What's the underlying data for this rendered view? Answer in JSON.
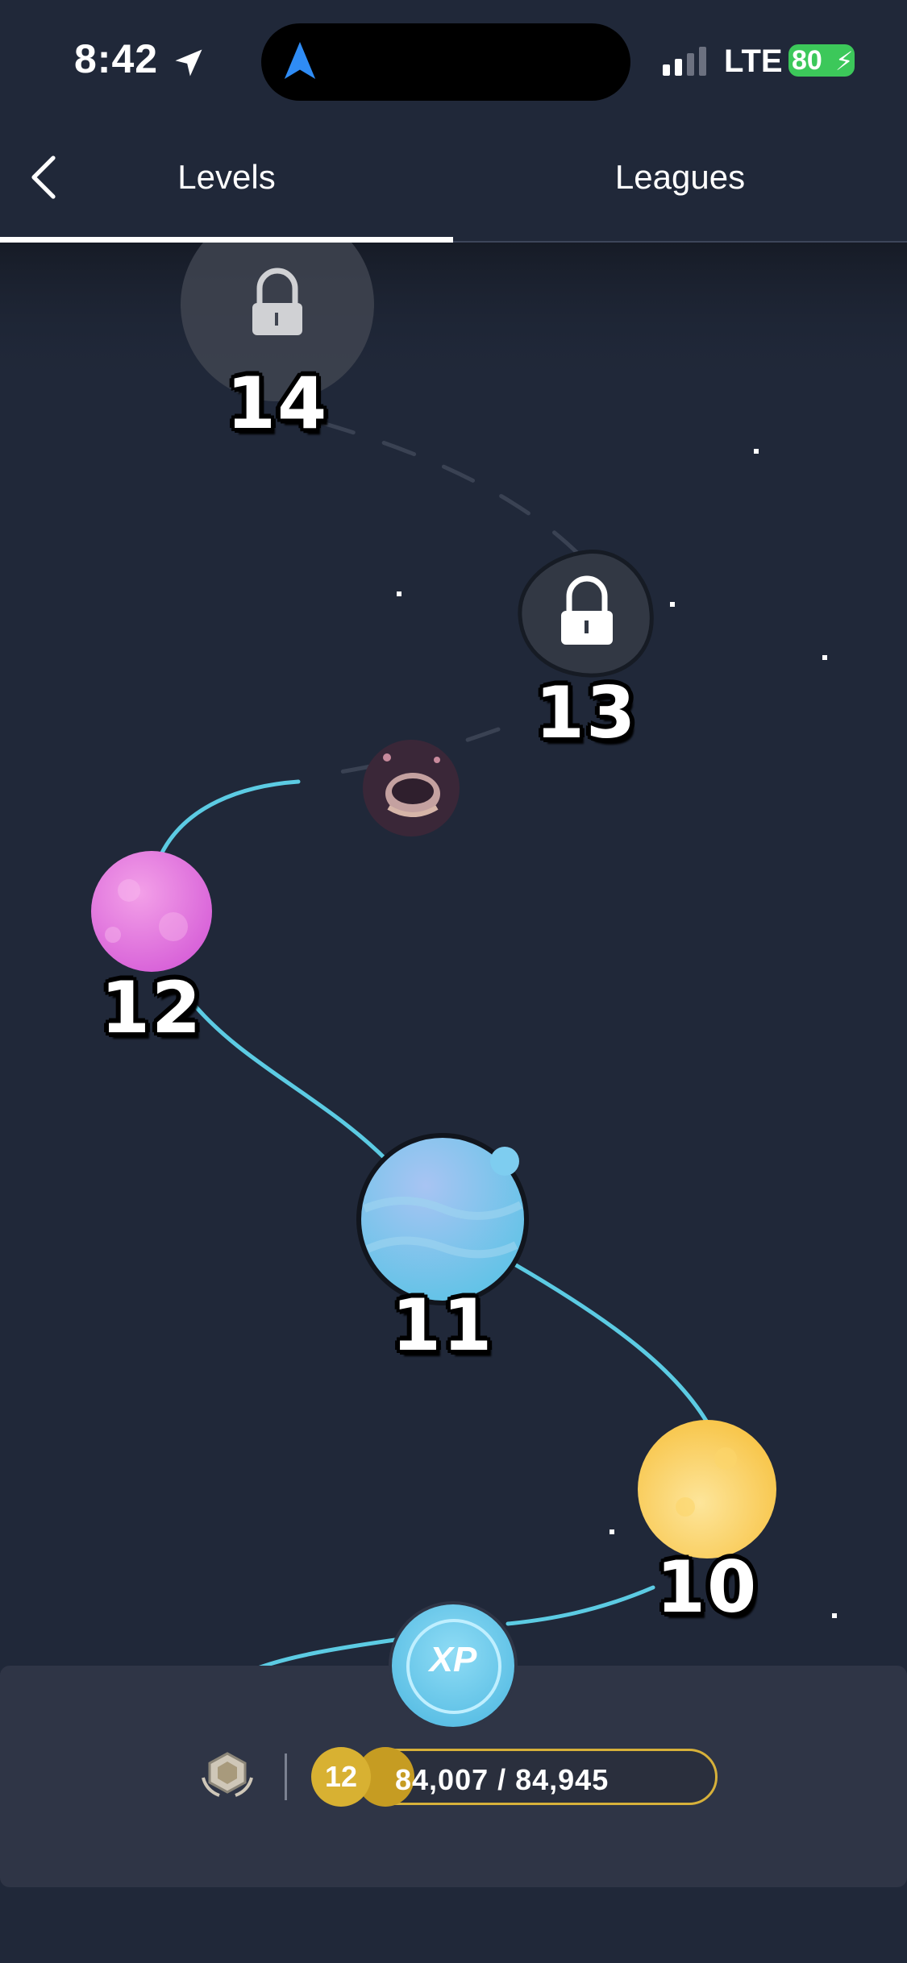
{
  "status_bar": {
    "time": "8:42",
    "network": "LTE",
    "battery": "80"
  },
  "header": {
    "tabs": [
      {
        "label": "Levels",
        "active": true
      },
      {
        "label": "Leagues",
        "active": false
      }
    ]
  },
  "levels": [
    {
      "number": "14",
      "state": "locked"
    },
    {
      "number": "13",
      "state": "locked"
    },
    {
      "number": "12",
      "state": "unlocked",
      "color": "#e27ae0"
    },
    {
      "number": "11",
      "state": "unlocked",
      "color": "#8fc6ef"
    },
    {
      "number": "10",
      "state": "unlocked",
      "color": "#f7c84a"
    }
  ],
  "progress": {
    "xp_badge": "XP",
    "current_level": "12",
    "xp_text": "84,007 / 84,945",
    "xp_current": 84007,
    "xp_target": 84945
  },
  "colors": {
    "background": "#202839",
    "path": "#5ccbe3",
    "panel": "#2f3546",
    "gold": "#d8b132"
  }
}
